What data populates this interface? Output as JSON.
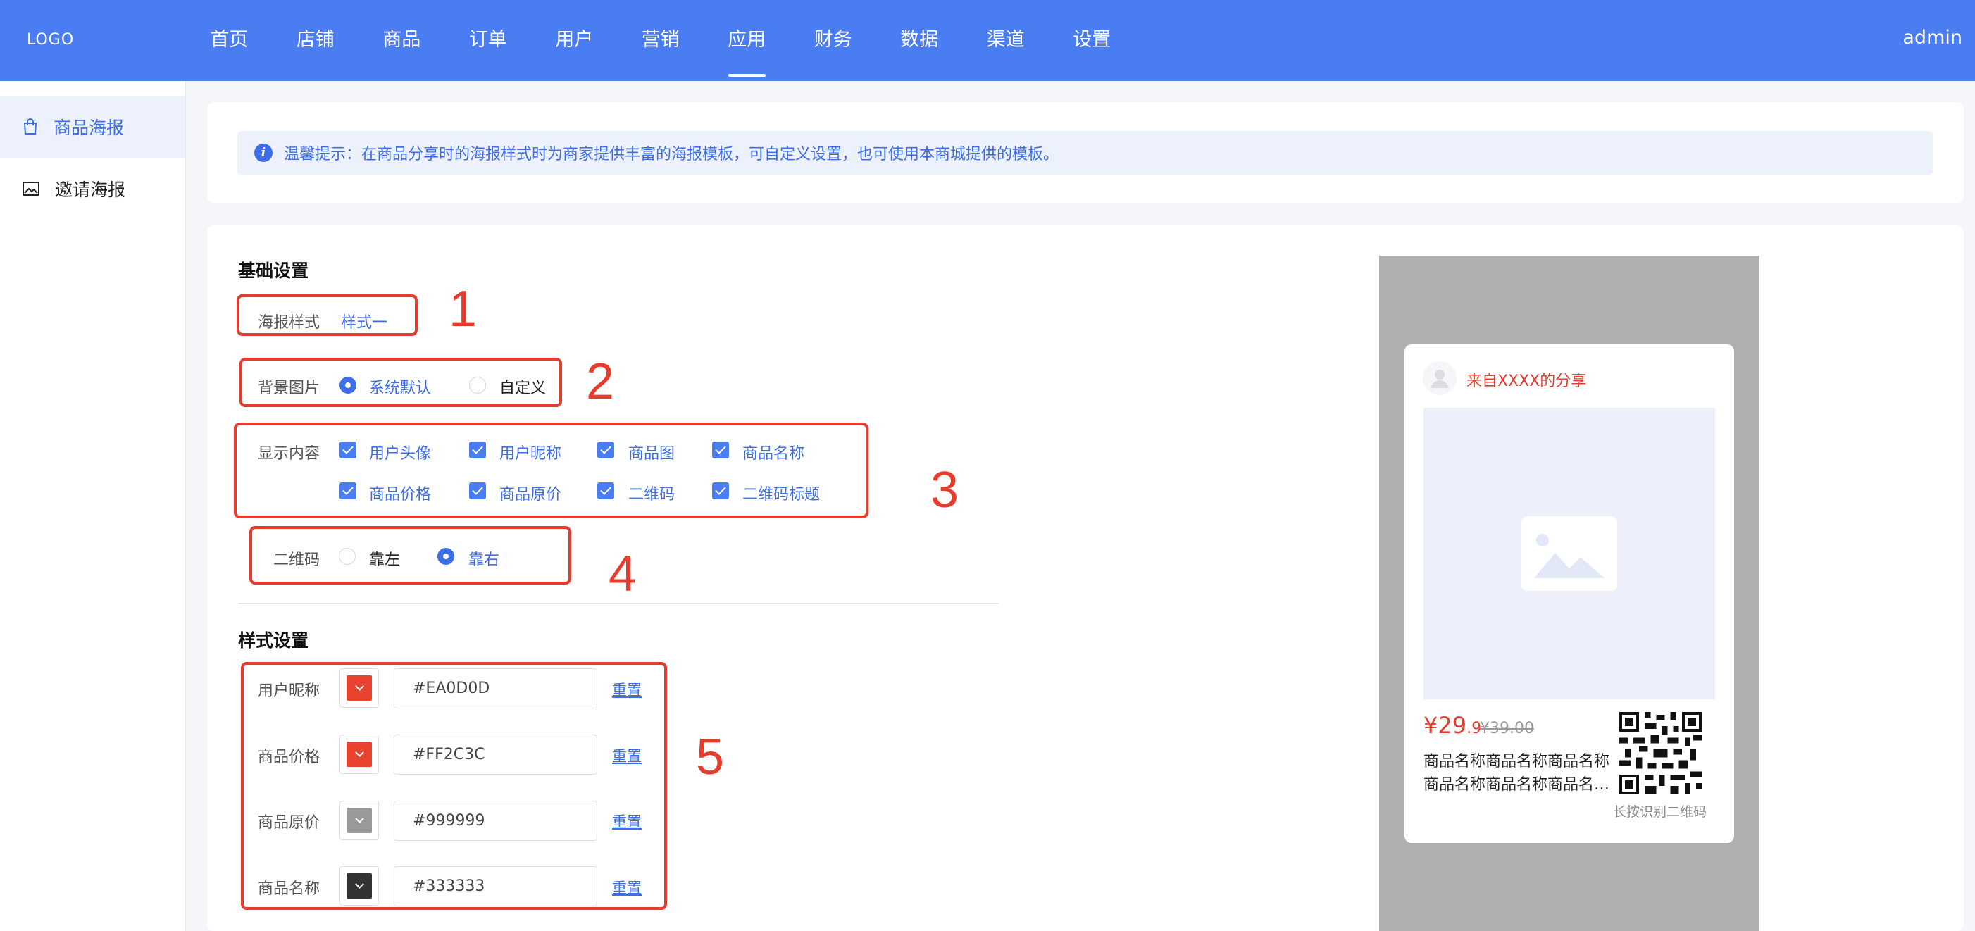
{
  "header": {
    "logo": "LOGO",
    "nav": [
      "首页",
      "店铺",
      "商品",
      "订单",
      "用户",
      "营销",
      "应用",
      "财务",
      "数据",
      "渠道",
      "设置"
    ],
    "active_nav": "应用",
    "user": "admin",
    "bg_color": "#4a7cf2"
  },
  "sidebar": {
    "items": [
      {
        "label": "商品海报",
        "icon": "shopping-bag-icon",
        "active": true
      },
      {
        "label": "邀请海报",
        "icon": "image-icon",
        "active": false
      }
    ]
  },
  "tip": {
    "icon": "info-icon",
    "text": "温馨提示：在商品分享时的海报样式时为商家提供丰富的海报模板，可自定义设置，也可使用本商城提供的模板。"
  },
  "basic": {
    "title": "基础设置",
    "poster_style": {
      "label": "海报样式",
      "value": "样式一"
    },
    "background": {
      "label": "背景图片",
      "options": [
        "系统默认",
        "自定义"
      ],
      "selected": "系统默认"
    },
    "display": {
      "label": "显示内容",
      "items": [
        "用户头像",
        "用户昵称",
        "商品图",
        "商品名称",
        "商品价格",
        "商品原价",
        "二维码",
        "二维码标题"
      ],
      "all_checked": true
    },
    "qrcode": {
      "label": "二维码",
      "options": [
        "靠左",
        "靠右"
      ],
      "selected": "靠右"
    }
  },
  "style": {
    "title": "样式设置",
    "reset_label": "重置",
    "rows": [
      {
        "label": "用户昵称",
        "value": "#EA0D0D",
        "swatch": "#e8432f"
      },
      {
        "label": "商品价格",
        "value": "#FF2C3C",
        "swatch": "#e8432f"
      },
      {
        "label": "商品原价",
        "value": "#999999",
        "swatch": "#999999"
      },
      {
        "label": "商品名称",
        "value": "#333333",
        "swatch": "#333333"
      }
    ]
  },
  "annotations": [
    "1",
    "2",
    "3",
    "4",
    "5"
  ],
  "preview": {
    "from_text": "来自XXXX的分享",
    "price_main": "¥29",
    "price_decimal": ".9",
    "original_price": "¥39.00",
    "name_line1": "商品名称商品名称商品名称",
    "name_line2": "商品名称商品名称商品名称商品名称",
    "qr_caption": "长按识别二维码"
  }
}
